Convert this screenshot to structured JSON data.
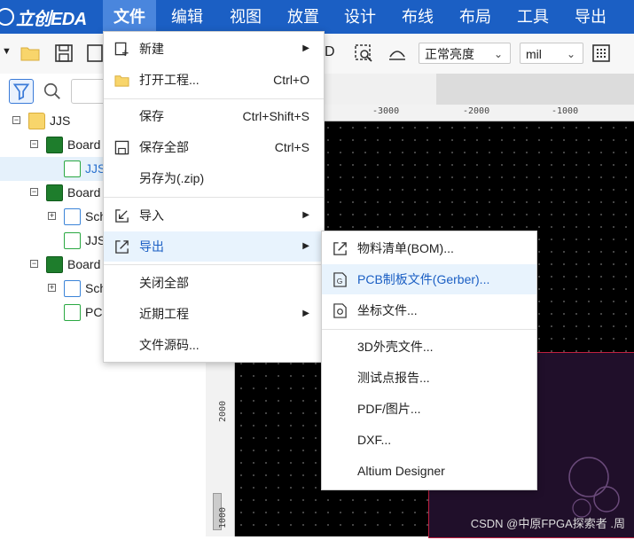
{
  "app": {
    "logo_text": "立创EDA"
  },
  "menubar": {
    "items": [
      {
        "label": "文件"
      },
      {
        "label": "编辑"
      },
      {
        "label": "视图"
      },
      {
        "label": "放置"
      },
      {
        "label": "设计"
      },
      {
        "label": "布线"
      },
      {
        "label": "布局"
      },
      {
        "label": "工具"
      },
      {
        "label": "导出"
      }
    ]
  },
  "toolbar": {
    "partial_label": "D",
    "brightness": {
      "value": "正常亮度"
    },
    "unit": {
      "value": "mil"
    }
  },
  "tree": {
    "rows": [
      {
        "label": "JJS"
      },
      {
        "label": "Board"
      },
      {
        "label": "JJS"
      },
      {
        "label": "Board"
      },
      {
        "label": "Sch"
      },
      {
        "label": "JJS"
      },
      {
        "label": "Board"
      },
      {
        "label": "Sch"
      },
      {
        "label": "PC"
      }
    ]
  },
  "ruler": {
    "top_labels": [
      "-3000",
      "-2000",
      "-1000"
    ],
    "left_labels": [
      "2000",
      "1000"
    ]
  },
  "file_menu": {
    "items": [
      {
        "label": "新建"
      },
      {
        "label": "打开工程...",
        "shortcut": "Ctrl+O"
      },
      {
        "label": "保存",
        "shortcut": "Ctrl+Shift+S"
      },
      {
        "label": "保存全部",
        "shortcut": "Ctrl+S"
      },
      {
        "label": "另存为(.zip)"
      },
      {
        "label": "导入"
      },
      {
        "label": "导出"
      },
      {
        "label": "关闭全部"
      },
      {
        "label": "近期工程"
      },
      {
        "label": "文件源码..."
      }
    ]
  },
  "export_menu": {
    "items": [
      {
        "label": "物料清单(BOM)..."
      },
      {
        "label": "PCB制板文件(Gerber)..."
      },
      {
        "label": "坐标文件..."
      },
      {
        "label": "3D外壳文件..."
      },
      {
        "label": "测试点报告..."
      },
      {
        "label": "PDF/图片..."
      },
      {
        "label": "DXF..."
      },
      {
        "label": "Altium Designer"
      }
    ]
  },
  "watermark": "CSDN @中原FPGA探索者 .周",
  "colors": {
    "menubar": "#1b5fc4",
    "highlight": "#e8f3fd",
    "active_menu": "#4a86dd"
  }
}
